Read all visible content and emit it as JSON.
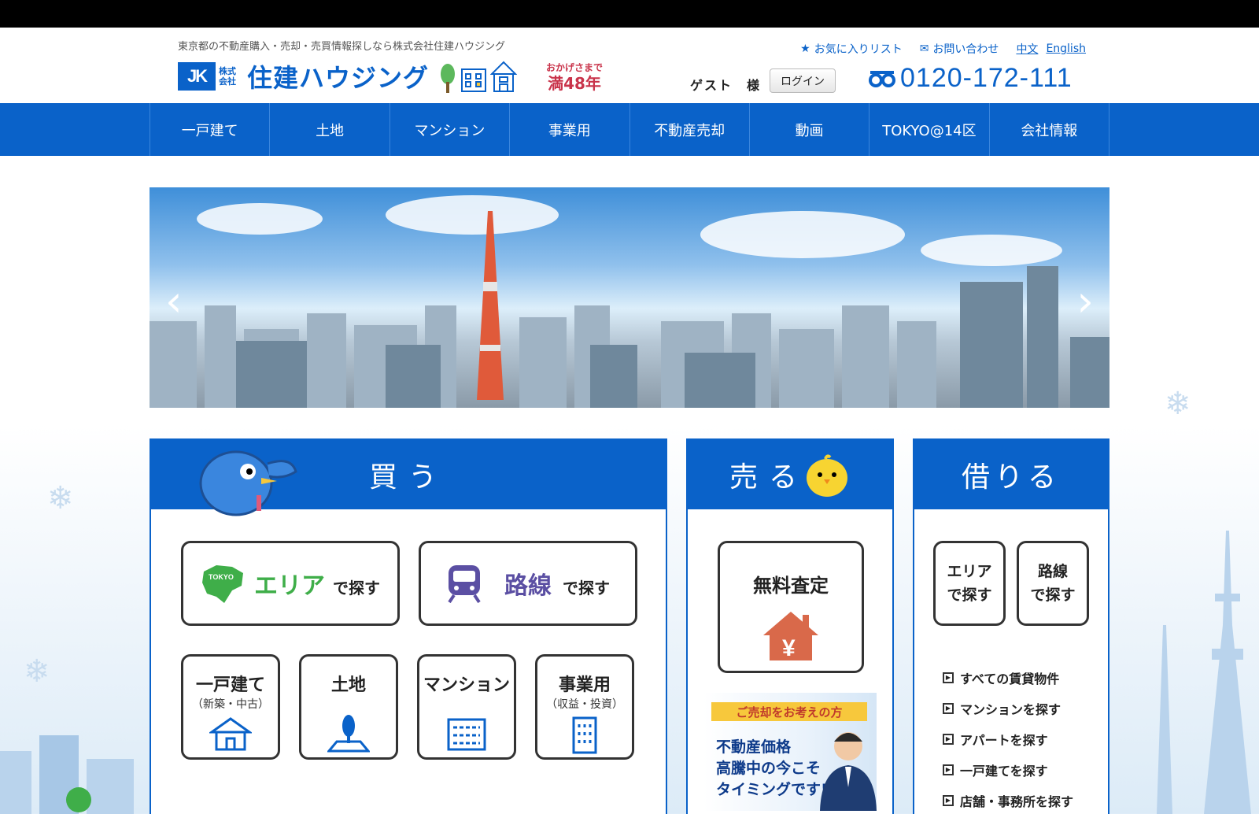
{
  "header": {
    "tagline": "東京都の不動産購入・売却・売買情報探しなら株式会社住建ハウジング",
    "logo_mark": "JK",
    "logo_kk": "株式会社",
    "logo_name": "住建ハウジング",
    "badge_line1": "おかげさまで",
    "badge_line2": "満48年",
    "links": {
      "favorites": "お気に入りリスト",
      "contact": "お問い合わせ",
      "chinese": "中文",
      "english": "English"
    },
    "guest": "ゲスト　様",
    "login": "ログイン",
    "phone": "0120-172-111"
  },
  "nav": {
    "items": [
      "一戸建て",
      "土地",
      "マンション",
      "事業用",
      "不動産売却",
      "動画",
      "TOKYO@14区",
      "会社情報"
    ]
  },
  "hero": {
    "prev": "‹",
    "next": "›"
  },
  "buy": {
    "title": "買う",
    "area_word": "エリア",
    "area_suffix": "で探す",
    "tokyo_tag": "TOKYO",
    "line_word": "路線",
    "line_suffix": "で探す",
    "types": [
      {
        "label": "一戸建て",
        "sub": "（新築・中古）"
      },
      {
        "label": "土地",
        "sub": ""
      },
      {
        "label": "マンション",
        "sub": ""
      },
      {
        "label": "事業用",
        "sub": "（収益・投資）"
      }
    ]
  },
  "sell": {
    "title": "売る",
    "appraisal": "無料査定",
    "yen": "¥",
    "promo_top": "ご売却をお考えの方",
    "promo_l1": "不動産価格",
    "promo_l2": "高騰中の今こそ",
    "promo_l3": "タイミングです!"
  },
  "rent": {
    "title": "借りる",
    "area_l1": "エリア",
    "area_l2": "で探す",
    "line_l1": "路線",
    "line_l2": "で探す",
    "links": [
      "すべての賃貸物件",
      "マンションを探す",
      "アパートを探す",
      "一戸建てを探す",
      "店舗・事務所を探す"
    ]
  },
  "colors": {
    "brand": "#0a62c9",
    "area_green": "#3fae49",
    "line_purple": "#5b4fa3",
    "house_orange": "#d9694a"
  }
}
